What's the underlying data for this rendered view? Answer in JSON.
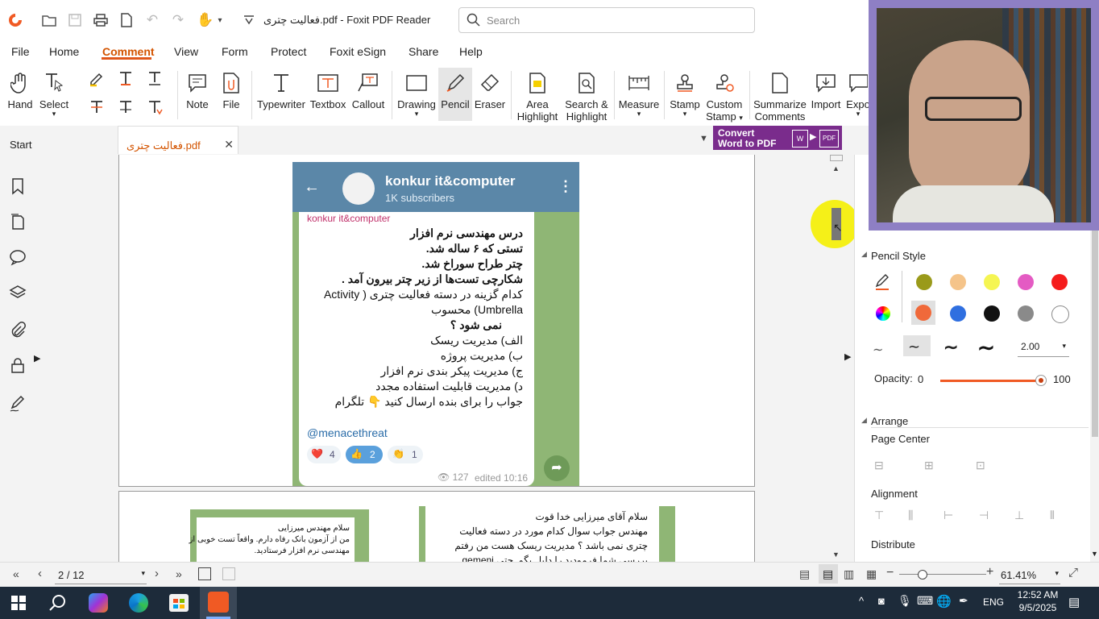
{
  "titlebar": {
    "doc_title": "فعالیت چتری.pdf - Foxit PDF Reader",
    "search_placeholder": "Search"
  },
  "menu": [
    "File",
    "Home",
    "Comment",
    "View",
    "Form",
    "Protect",
    "Foxit eSign",
    "Share",
    "Help"
  ],
  "ribbon": {
    "hand": "Hand",
    "select": "Select",
    "note": "Note",
    "file": "File",
    "typewriter": "Typewriter",
    "textbox": "Textbox",
    "callout": "Callout",
    "drawing": "Drawing",
    "pencil": "Pencil",
    "eraser": "Eraser",
    "area_highlight_1": "Area",
    "area_highlight_2": "Highlight",
    "search_highlight_1": "Search &",
    "search_highlight_2": "Highlight",
    "measure": "Measure",
    "stamp": "Stamp",
    "custom_stamp_1": "Custom",
    "custom_stamp_2": "Stamp",
    "summarize_1": "Summarize",
    "summarize_2": "Comments",
    "import": "Import",
    "export": "Expo"
  },
  "tabs": {
    "start": "Start",
    "active": "فعالیت چتری.pdf",
    "convert_1": "Convert",
    "convert_2": "Word to PDF"
  },
  "telegram": {
    "channel": "konkur it&computer",
    "subscribers": "1K subscribers",
    "sender": "konkur it&computer",
    "lines": [
      "درس مهندسی نرم افزار",
      "تستی که ۶ ساله شد.",
      "چتر طراح سوراخ شد.",
      "شکارچی تست‌ها از زیر چتر بیرون آمد .",
      "کدام گزینه در دسته فعالیت چتری ( Activity",
      "Umbrella) محسوب",
      "نمی شود ؟",
      "الف) مدیریت ریسک",
      "ب) مدیریت پروژه",
      "ج) مدیریت پیکر بندی نرم افزار",
      "د) مدیریت قابلیت استفاده مجدد",
      "جواب را برای بنده ارسال کنید 👇 تلگرام"
    ],
    "handle": "@menacethreat",
    "reactions": [
      {
        "icon": "❤️",
        "count": "4"
      },
      {
        "icon": "👍",
        "count": "2"
      },
      {
        "icon": "👏",
        "count": "1"
      }
    ],
    "views": "127",
    "edited": "edited 10:16"
  },
  "page2": {
    "left_lines": [
      "سلام مهندس میرزایی",
      "من از آزمون بانک رفاه دارم. واقعاً تست خوبی از",
      "مهندسی نرم افزار فرستادید."
    ],
    "right_lines": [
      "سلام آقای میرزایی خدا قوت",
      "مهندس  جواب سوال کدام مورد در دسته فعالیت",
      "چتری نمی باشد ؟ مدیریت ریسک هست من رفتم",
      "بررسی شما فرمودید را دلیل بگو. حتی gemeni"
    ]
  },
  "right_panel": {
    "pencil_style": "Pencil Style",
    "line_width": "2.00",
    "opacity_label": "Opacity:",
    "opacity_min": "0",
    "opacity_max": "100",
    "arrange": "Arrange",
    "page_center": "Page Center",
    "alignment": "Alignment",
    "distribute": "Distribute",
    "colors_row1": [
      "#9a9a1a",
      "#f5c48a",
      "#f5f552",
      "#e45bc3",
      "#f51c1c"
    ],
    "colors_row2": [
      "#f0693a",
      "#2f6fe0",
      "#111111",
      "#8a8a8a",
      "#ffffff"
    ]
  },
  "status": {
    "page": "2 / 12",
    "zoom": "61.41%"
  },
  "taskbar": {
    "lang": "ENG",
    "time": "12:52 AM",
    "date": "9/5/2025"
  }
}
